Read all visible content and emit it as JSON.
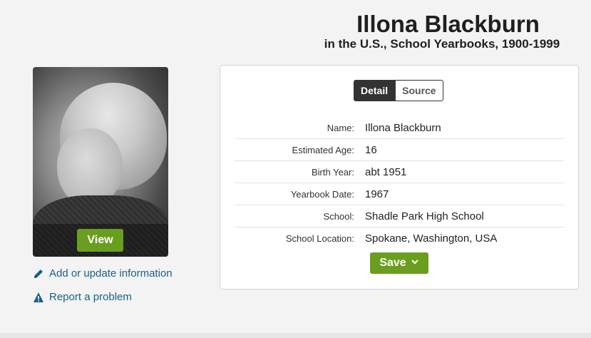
{
  "header": {
    "title": "Illona Blackburn",
    "subtitle": "in the U.S., School Yearbooks, 1900-1999"
  },
  "photo": {
    "view_label": "View"
  },
  "side_links": [
    {
      "label": "Add or update information",
      "icon": "pencil-icon"
    },
    {
      "label": "Report a problem",
      "icon": "warning-icon"
    }
  ],
  "tabs": [
    {
      "label": "Detail",
      "active": true
    },
    {
      "label": "Source",
      "active": false
    }
  ],
  "details": [
    {
      "label": "Name:",
      "value": "Illona Blackburn"
    },
    {
      "label": "Estimated Age:",
      "value": "16"
    },
    {
      "label": "Birth Year:",
      "value": "abt 1951"
    },
    {
      "label": "Yearbook Date:",
      "value": "1967"
    },
    {
      "label": "School:",
      "value": "Shadle Park High School"
    },
    {
      "label": "School Location:",
      "value": "Spokane, Washington, USA"
    }
  ],
  "save": {
    "label": "Save",
    "icon": "chevron-down-icon"
  },
  "colors": {
    "accent_green": "#6a9e1f",
    "link_blue": "#1a5f86",
    "tab_dark": "#333333"
  }
}
